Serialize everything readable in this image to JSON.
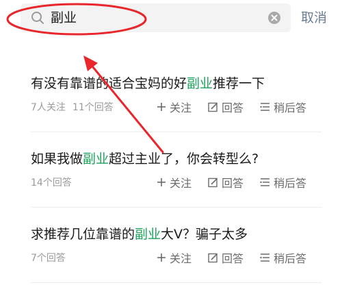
{
  "search": {
    "query": "副业",
    "cancel_label": "取消"
  },
  "results": [
    {
      "title_pre": "有没有靠谱的适合宝妈的好",
      "title_hl": "副业",
      "title_post": "推荐一下",
      "followers": "7人关注",
      "answers": "11个回答"
    },
    {
      "title_pre": "如果我做",
      "title_hl": "副业",
      "title_post": "超过主业了，你会转型么?",
      "followers": "",
      "answers": "14个回答"
    },
    {
      "title_pre": "求推荐几位靠谱的",
      "title_hl": "副业",
      "title_post": "大V？骗子太多",
      "followers": "",
      "answers": "7个回答"
    }
  ],
  "actions": {
    "follow_label": "关注",
    "answer_label": "回答",
    "later_label": "稍后答"
  },
  "colors": {
    "highlight_green": "#1aa359",
    "annotation_red": "#e8262b",
    "cancel_blue": "#6a7d94"
  },
  "icons": {
    "search": "search-icon",
    "clear": "clear-icon",
    "follow": "plus-icon",
    "answer": "edit-icon",
    "later": "list-icon"
  }
}
